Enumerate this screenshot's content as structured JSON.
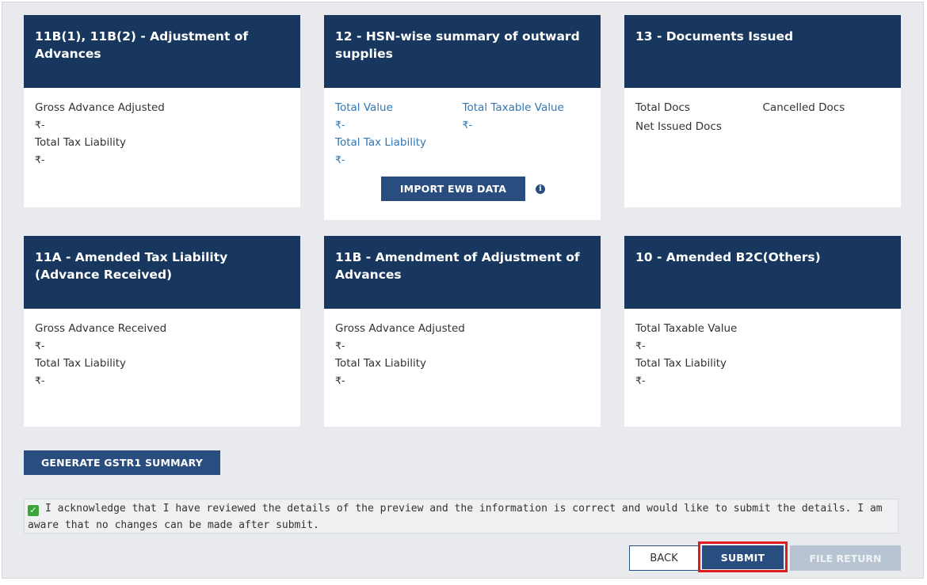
{
  "currency": "₹-",
  "cards": [
    {
      "title": "11B(1), 11B(2) - Adjustment of Advances",
      "lbl1": "Gross Advance Adjusted",
      "lbl2": "Total Tax Liability"
    },
    {
      "title": "12 - HSN-wise summary of outward supplies",
      "lbl1": "Total Value",
      "lbl2": "Total Taxable Value",
      "lbl3": "Total Tax Liability",
      "button": "IMPORT EWB DATA"
    },
    {
      "title": "13 - Documents Issued",
      "lbl1": "Total Docs",
      "lbl2": "Cancelled Docs",
      "lbl3": "Net Issued Docs"
    },
    {
      "title": "11A - Amended Tax Liability (Advance Received)",
      "lbl1": "Gross Advance Received",
      "lbl2": "Total Tax Liability"
    },
    {
      "title": "11B - Amendment of Adjustment of Advances",
      "lbl1": "Gross Advance Adjusted",
      "lbl2": "Total Tax Liability"
    },
    {
      "title": "10 - Amended B2C(Others)",
      "lbl1": "Total Taxable Value",
      "lbl2": "Total Tax Liability"
    }
  ],
  "generate_button": "GENERATE GSTR1 SUMMARY",
  "acknowledgement": "I acknowledge that I have reviewed the details of the preview and the information is correct and would like to submit the details. I am aware that no changes can be made after submit.",
  "actions": {
    "back": "BACK",
    "submit": "SUBMIT",
    "file_return": "FILE RETURN"
  },
  "colors": {
    "header": "#17375e",
    "button": "#2a4d80",
    "highlight": "#e01b1b",
    "checkbox": "#3aa53a"
  },
  "icons": {
    "info": "info-icon",
    "check": "checkmark-icon"
  }
}
